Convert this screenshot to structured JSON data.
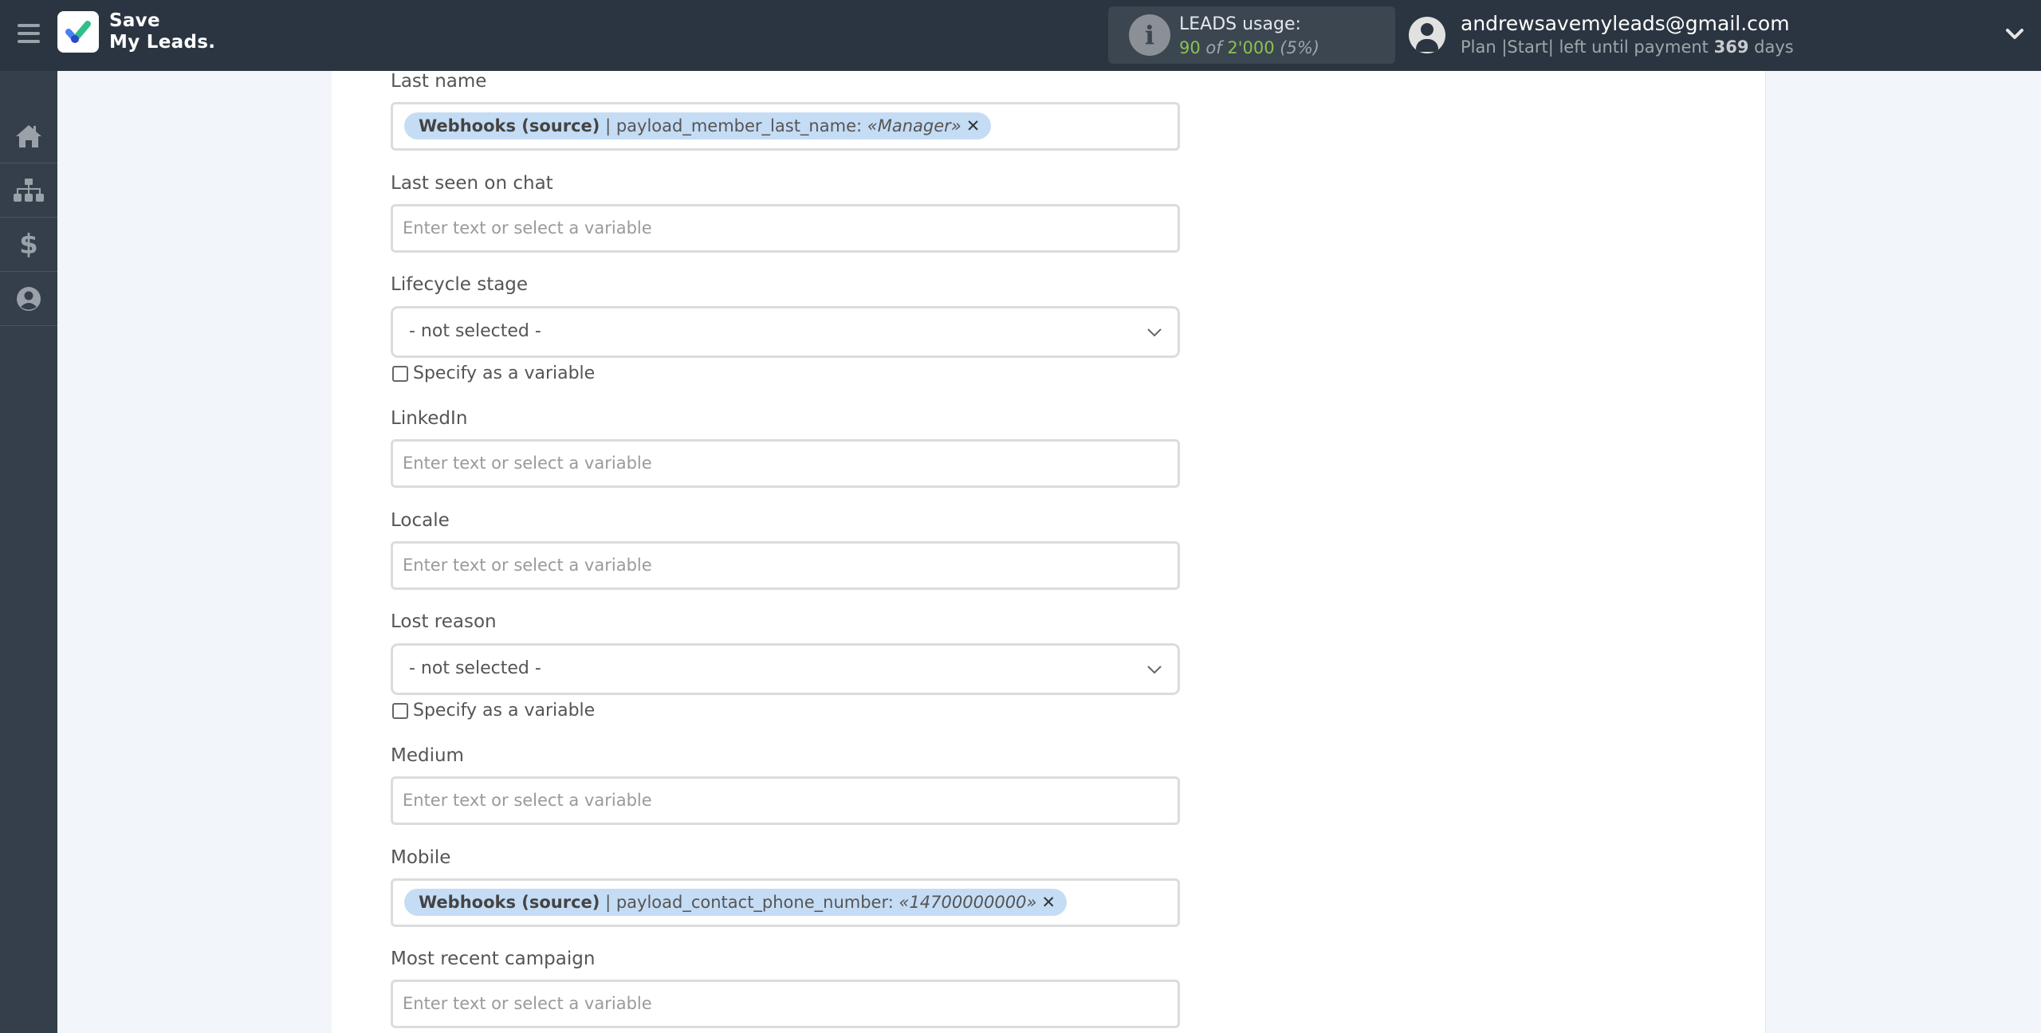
{
  "app": {
    "logo_line1": "Save",
    "logo_line2": "My Leads."
  },
  "header": {
    "usage_title": "LEADS usage:",
    "usage_used": "90",
    "usage_of": "of",
    "usage_total": "2'000",
    "usage_percent": "(5%)",
    "user_email": "andrewsavemyleads@gmail.com",
    "plan_prefix": "Plan |Start| left until payment",
    "plan_days": "369",
    "plan_suffix": "days"
  },
  "sidebar": {
    "items": [
      {
        "name": "home",
        "icon": "home-icon"
      },
      {
        "name": "connections",
        "icon": "sitemap-icon"
      },
      {
        "name": "billing",
        "icon": "dollar-icon"
      },
      {
        "name": "account",
        "icon": "user-circle-icon"
      }
    ]
  },
  "form": {
    "placeholder": "Enter text or select a variable",
    "specify_variable_label": "Specify as a variable",
    "fields": {
      "last_name": {
        "label": "Last name",
        "chip": {
          "source": "Webhooks (source)",
          "sep": " | ",
          "field": "payload_member_last_name: ",
          "value": "«Manager»",
          "remove": "✕"
        }
      },
      "last_seen_on_chat": {
        "label": "Last seen on chat",
        "value": ""
      },
      "lifecycle_stage": {
        "label": "Lifecycle stage",
        "selected": "- not selected -",
        "specify_as_variable": false
      },
      "linkedin": {
        "label": "LinkedIn",
        "value": ""
      },
      "locale": {
        "label": "Locale",
        "value": ""
      },
      "lost_reason": {
        "label": "Lost reason",
        "selected": "- not selected -",
        "specify_as_variable": false
      },
      "medium": {
        "label": "Medium",
        "value": ""
      },
      "mobile": {
        "label": "Mobile",
        "chip": {
          "source": "Webhooks (source)",
          "sep": " | ",
          "field": "payload_contact_phone_number: ",
          "value": "«14700000000»",
          "remove": "✕"
        }
      },
      "most_recent_campaign": {
        "label": "Most recent campaign",
        "value": ""
      }
    }
  },
  "colors": {
    "header_bg": "#2b3541",
    "sidebar_bg": "#343f4b",
    "page_bg": "#f2f6fb",
    "chip_bg": "#c5dcf5",
    "usage_green": "#8cc152"
  }
}
